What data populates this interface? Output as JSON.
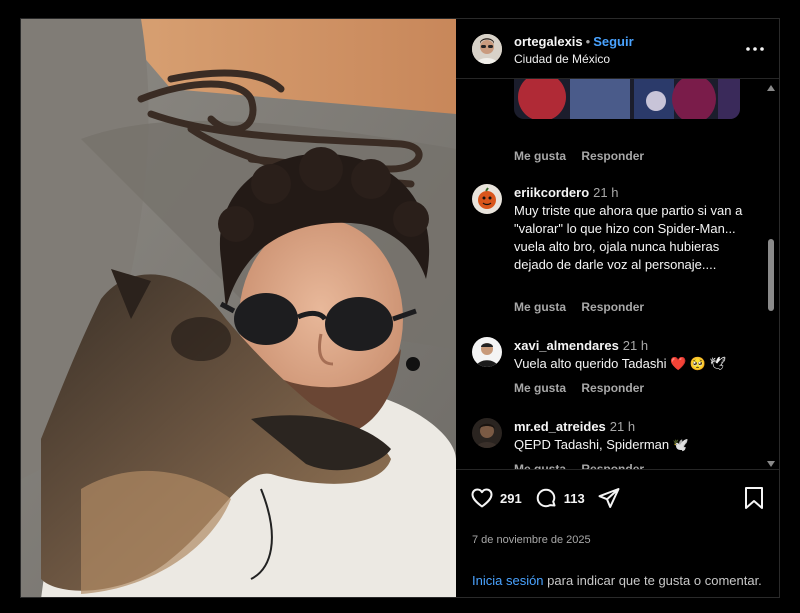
{
  "post": {
    "username": "ortegalexis",
    "separator": "•",
    "follow_label": "Seguir",
    "location": "Ciudad de México",
    "more_icon": "more-horizontal-icon"
  },
  "comment_actions": {
    "like_label": "Me gusta",
    "reply_label": "Responder"
  },
  "comments": [
    {
      "username": "eriikcordero",
      "time": "21 h",
      "text": "Muy triste que ahora que partio si van a \"valorar\" lo que hizo con Spider-Man... vuela alto bro, ojala nunca hubieras dejado de darle voz al personaje...."
    },
    {
      "username": "xavi_almendares",
      "time": "21 h",
      "text": "Vuela alto querido Tadashi ❤️ 🥺 🕊"
    },
    {
      "username": "mr.ed_atreides",
      "time": "21 h",
      "text": "QEPD Tadashi, Spiderman 🕊️"
    }
  ],
  "footer": {
    "likes": "291",
    "comments": "113",
    "date": "7 de noviembre de 2025",
    "login_link": "Inicia sesión",
    "login_rest": " para indicar que te gusta o comentar."
  },
  "colors": {
    "link": "#4aa3ff",
    "panel_bg": "#000000",
    "muted": "#a8a8a8"
  }
}
